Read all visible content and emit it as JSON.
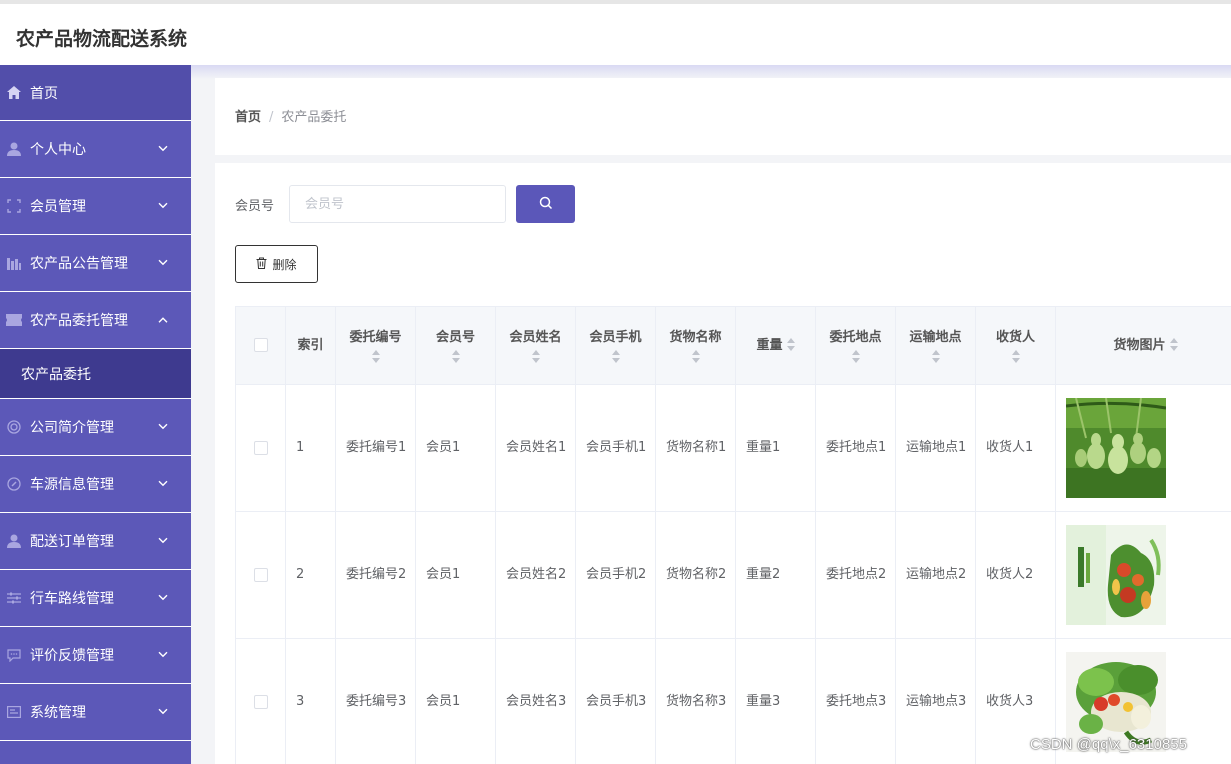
{
  "app": {
    "title": "农产品物流配送系统"
  },
  "sidebar": {
    "items": [
      {
        "label": "首页",
        "icon": "home-icon",
        "has_arrow": false
      },
      {
        "label": "个人中心",
        "icon": "user-icon",
        "has_arrow": true
      },
      {
        "label": "会员管理",
        "icon": "frame-icon",
        "has_arrow": true
      },
      {
        "label": "农产品公告管理",
        "icon": "chart-icon",
        "has_arrow": true
      },
      {
        "label": "农产品委托管理",
        "icon": "ticket-icon",
        "has_arrow": true,
        "expanded": true
      },
      {
        "label": "公司简介管理",
        "icon": "circle-icon",
        "has_arrow": true
      },
      {
        "label": "车源信息管理",
        "icon": "compass-icon",
        "has_arrow": true
      },
      {
        "label": "配送订单管理",
        "icon": "user-icon",
        "has_arrow": true
      },
      {
        "label": "行车路线管理",
        "icon": "sliders-icon",
        "has_arrow": true
      },
      {
        "label": "评价反馈管理",
        "icon": "chat-icon",
        "has_arrow": true
      },
      {
        "label": "系统管理",
        "icon": "panel-icon",
        "has_arrow": true
      }
    ],
    "submenu": {
      "label": "农产品委托"
    }
  },
  "breadcrumb": {
    "home": "首页",
    "separator": "/",
    "current": "农产品委托"
  },
  "search": {
    "label": "会员号",
    "placeholder": "会员号",
    "value": ""
  },
  "actions": {
    "delete_label": "删除"
  },
  "table": {
    "columns": [
      "索引",
      "委托编号",
      "会员号",
      "会员姓名",
      "会员手机",
      "货物名称",
      "重量",
      "委托地点",
      "运输地点",
      "收货人",
      "货物图片"
    ],
    "rows": [
      {
        "index": "1",
        "entrust_no": "委托编号1",
        "member_no": "会员1",
        "member_name": "会员姓名1",
        "member_phone": "会员手机1",
        "goods_name": "货物名称1",
        "weight": "重量1",
        "entrust_place": "委托地点1",
        "transport_place": "运输地点1",
        "receiver": "收货人1",
        "image": "gourd-photo"
      },
      {
        "index": "2",
        "entrust_no": "委托编号2",
        "member_no": "会员1",
        "member_name": "会员姓名2",
        "member_phone": "会员手机2",
        "goods_name": "货物名称2",
        "weight": "重量2",
        "entrust_place": "委托地点2",
        "transport_place": "运输地点2",
        "receiver": "收货人2",
        "image": "vegetable-poster"
      },
      {
        "index": "3",
        "entrust_no": "委托编号3",
        "member_no": "会员1",
        "member_name": "会员姓名3",
        "member_phone": "会员手机3",
        "goods_name": "货物名称3",
        "weight": "重量3",
        "entrust_place": "委托地点3",
        "transport_place": "运输地点3",
        "receiver": "收货人3",
        "image": "vegetable-basket"
      }
    ]
  },
  "watermark": "CSDN @qq\\x_6310855",
  "colors": {
    "sidebar": "#5c58b8",
    "accent": "#5b57b9",
    "submenu": "#3e3a8f"
  }
}
